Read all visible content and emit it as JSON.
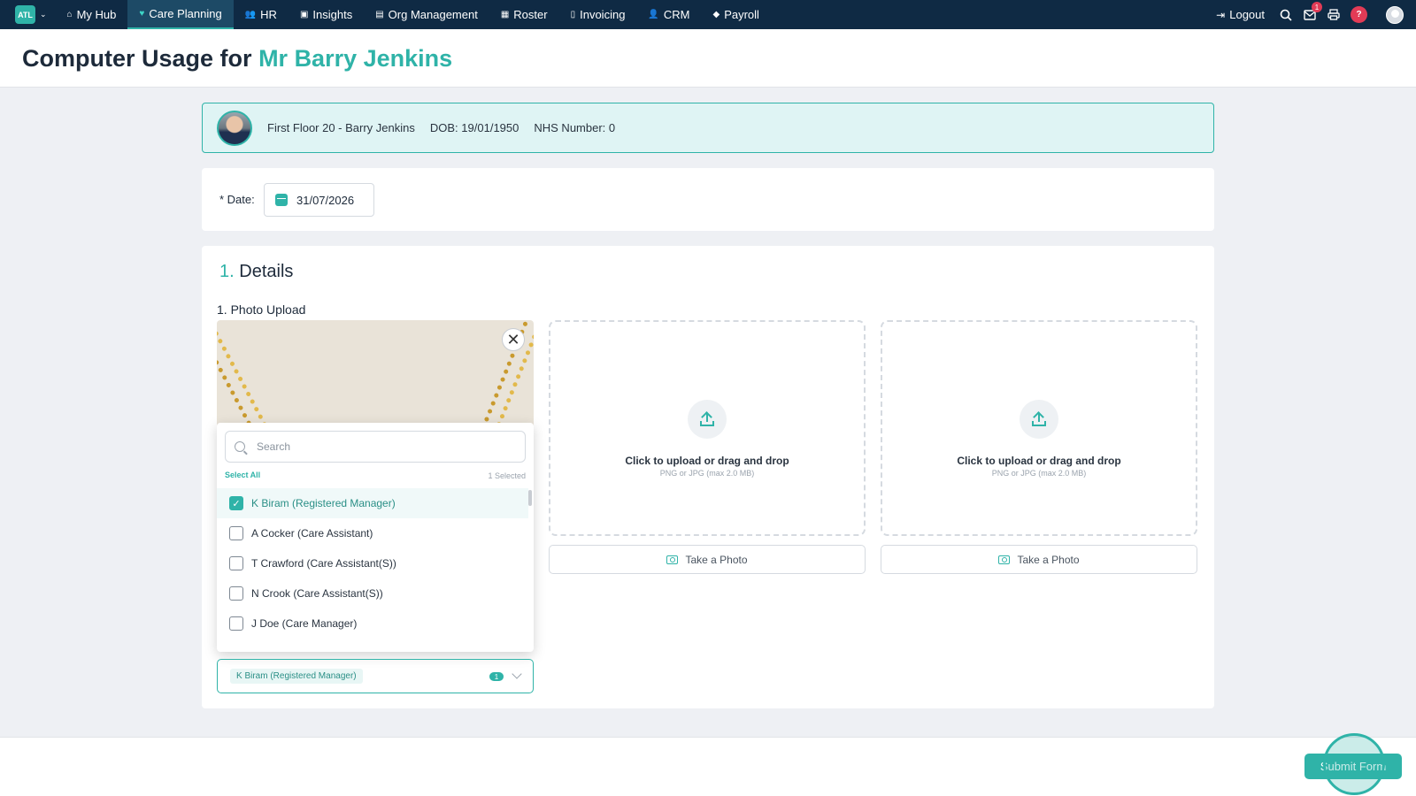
{
  "nav": {
    "logo": "ATL",
    "items": [
      {
        "label": "My Hub",
        "icon": "home-icon",
        "glyph": "⌂"
      },
      {
        "label": "Care Planning",
        "icon": "heart-icon",
        "glyph": "♥",
        "active": true
      },
      {
        "label": "HR",
        "icon": "people-icon",
        "glyph": "👥"
      },
      {
        "label": "Insights",
        "icon": "chart-icon",
        "glyph": "▣"
      },
      {
        "label": "Org Management",
        "icon": "building-icon",
        "glyph": "▤"
      },
      {
        "label": "Roster",
        "icon": "calendar-icon",
        "glyph": "▦"
      },
      {
        "label": "Invoicing",
        "icon": "document-icon",
        "glyph": "▯"
      },
      {
        "label": "CRM",
        "icon": "contacts-icon",
        "glyph": "👤"
      },
      {
        "label": "Payroll",
        "icon": "tag-icon",
        "glyph": "◆"
      }
    ],
    "logout": "Logout",
    "notification_count": "1",
    "help": "?"
  },
  "header": {
    "title_prefix": "Computer Usage for",
    "resident_name": "Mr Barry Jenkins"
  },
  "resident": {
    "location": "First Floor 20 - Barry Jenkins",
    "dob_label": "DOB:",
    "dob": "19/01/1950",
    "nhs_label": "NHS Number:",
    "nhs": "0"
  },
  "date_field": {
    "label": "* Date:",
    "value": "31/07/2026"
  },
  "section": {
    "number": "1.",
    "title": "Details",
    "photo_label": "1. Photo Upload"
  },
  "dropdown": {
    "search_placeholder": "Search",
    "select_all": "Select All",
    "selected_count": "1 Selected",
    "options": [
      {
        "label": "K Biram (Registered Manager)",
        "checked": true
      },
      {
        "label": "A Cocker (Care Assistant)",
        "checked": false
      },
      {
        "label": "T Crawford (Care Assistant(S))",
        "checked": false
      },
      {
        "label": "N Crook (Care Assistant(S))",
        "checked": false
      },
      {
        "label": "J Doe (Care Manager)",
        "checked": false
      }
    ],
    "selected_tag": "K Biram (Registered Manager)",
    "selected_pill": "1"
  },
  "upload": {
    "title": "Click to upload or drag and drop",
    "subtitle": "PNG or JPG (max 2.0 MB)",
    "take_photo": "Take a Photo"
  },
  "footer": {
    "submit": "Submit Form"
  }
}
